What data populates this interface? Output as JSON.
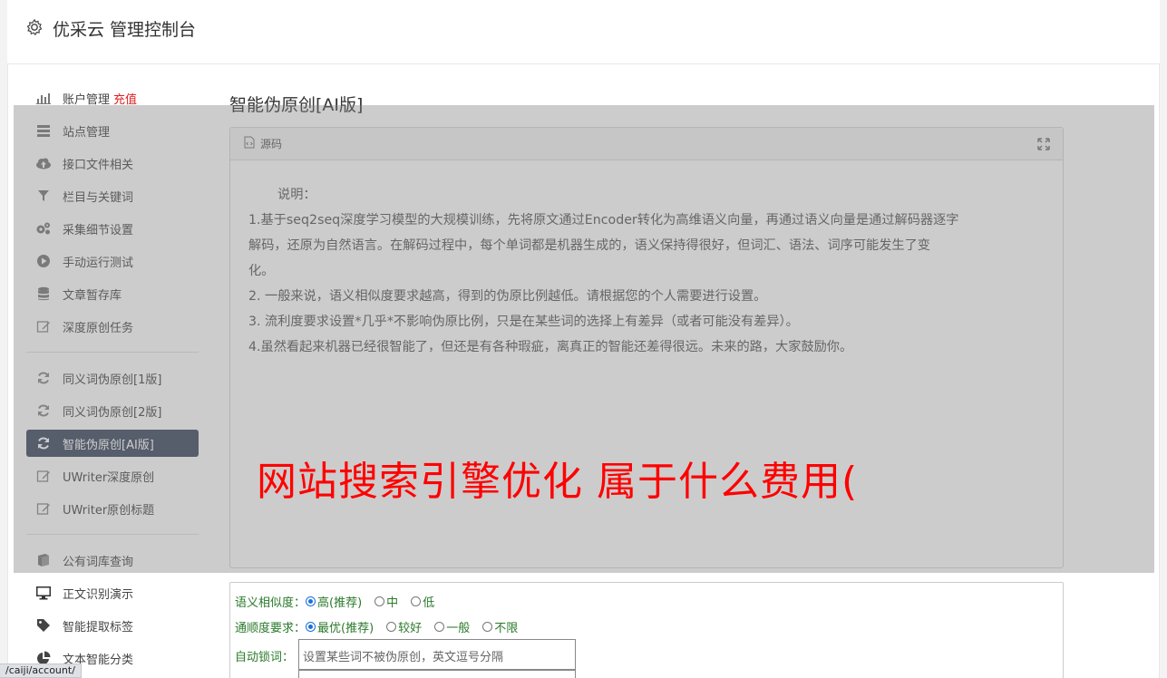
{
  "header": {
    "title": "优采云 管理控制台",
    "icon": "gear-icon"
  },
  "sidebar": {
    "group1": [
      {
        "label": "账户管理",
        "extra": "充值",
        "icon": "bar-chart-icon"
      },
      {
        "label": "站点管理",
        "icon": "server-icon"
      },
      {
        "label": "接口文件相关",
        "icon": "cloud-upload-icon"
      },
      {
        "label": "栏目与关键词",
        "icon": "filter-icon"
      },
      {
        "label": "采集细节设置",
        "icon": "cogs-icon"
      },
      {
        "label": "手动运行测试",
        "icon": "play-circle-icon"
      },
      {
        "label": "文章暂存库",
        "icon": "database-icon"
      },
      {
        "label": "深度原创任务",
        "icon": "edit-icon"
      }
    ],
    "group2": [
      {
        "label": "同义词伪原创[1版]",
        "icon": "refresh-icon"
      },
      {
        "label": "同义词伪原创[2版]",
        "icon": "refresh-icon"
      },
      {
        "label": "智能伪原创[AI版]",
        "icon": "refresh-icon",
        "active": true
      },
      {
        "label": "UWriter深度原创",
        "icon": "edit-icon"
      },
      {
        "label": "UWriter原创标题",
        "icon": "edit-icon"
      }
    ],
    "group3": [
      {
        "label": "公有词库查询",
        "icon": "book-icon"
      },
      {
        "label": "正文识别演示",
        "icon": "monitor-icon"
      },
      {
        "label": "智能提取标签",
        "icon": "tag-icon"
      },
      {
        "label": "文本智能分类",
        "icon": "pie-chart-icon"
      }
    ]
  },
  "main": {
    "page_title": "智能伪原创[AI版]",
    "panel": {
      "header": "源码",
      "lines": [
        "说明：",
        "1.基于seq2seq深度学习模型的大规模训练，先将原文通过Encoder转化为高维语义向量，再通过语义向量是通过解码器逐字",
        "解码，还原为自然语言。在解码过程中，每个单词都是机器生成的，语义保持得很好，但词汇、语法、词序可能发生了变",
        "化。",
        "2. 一般来说，语义相似度要求越高，得到的伪原比例越低。请根据您的个人需要进行设置。",
        "3. 流利度要求设置*几乎*不影响伪原比例，只是在某些词的选择上有差异（或者可能没有差异）。",
        "4.虽然看起来机器已经很智能了，但还是有各种瑕疵，离真正的智能还差得很远。未来的路，大家鼓励你。"
      ]
    },
    "overlay_text": "网站搜索引擎优化 属于什么费用(",
    "settings": {
      "similarity_label": "语义相似度：",
      "similarity_options": [
        "高(推荐)",
        "中",
        "低"
      ],
      "fluency_label": "通顺度要求：",
      "fluency_options": [
        "最优(推荐)",
        "较好",
        "一般",
        "不限"
      ],
      "lock_label": "自动锁词：",
      "lock_placeholder": "设置某些词不被伪原创，英文逗号分隔"
    }
  },
  "status_url": "/caiji/account/",
  "colors": {
    "active_bg": "#3b475e",
    "promo": "#ff0000",
    "charge": "#e02020",
    "option_text": "#2a7a2a"
  }
}
